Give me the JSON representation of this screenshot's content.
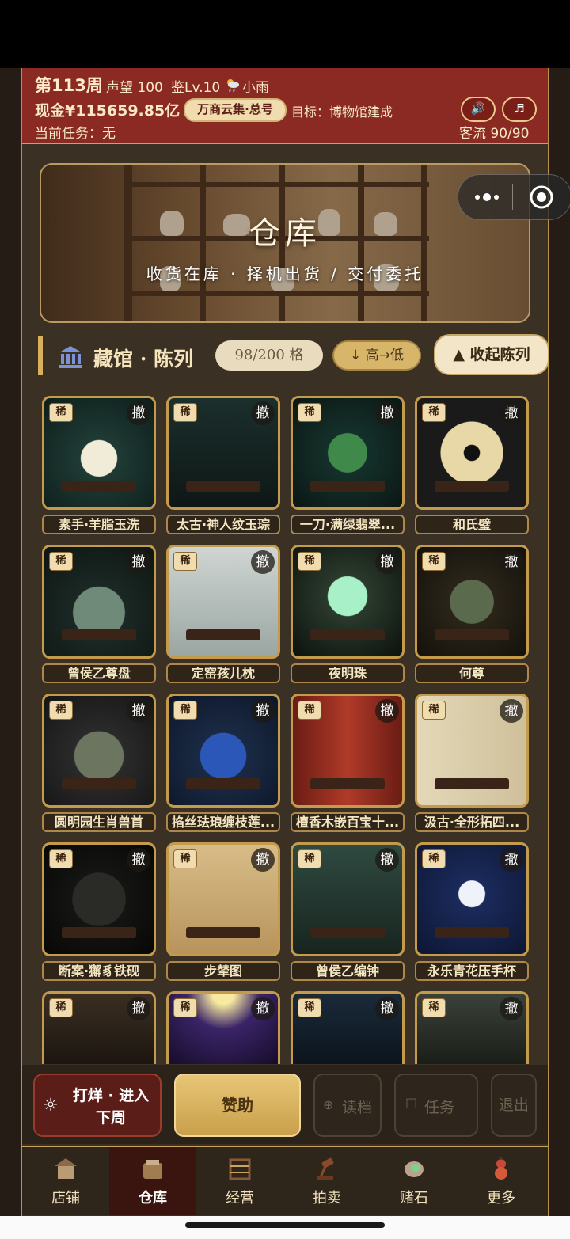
{
  "header": {
    "week": "第113周",
    "prestige": "声望 100",
    "level": "鉴Lv.10",
    "weather_icon": "cloud-rain-icon",
    "weather": "小雨",
    "cash": "现金¥115659.85亿",
    "shop_badge": "万商云集·总号",
    "goal": "目标：博物馆建成",
    "task": "当前任务：无",
    "sound_icon": "speaker-icon",
    "music_icon": "music-note-icon",
    "visitors": "客流 90/90"
  },
  "banner": {
    "title": "仓库",
    "subtitle": "收货在库 · 择机出货 / 交付委托"
  },
  "section": {
    "title": "藏馆 · 陈列",
    "count": "98/200 格",
    "sort": "↓ 高→低",
    "collapse": "▲ 收起陈列"
  },
  "labels": {
    "rare": "稀",
    "withdraw": "撤"
  },
  "items": [
    {
      "name": "素手·羊脂玉洗"
    },
    {
      "name": "太古·神人纹玉琮"
    },
    {
      "name": "一刀·满绿翡翠..."
    },
    {
      "name": "和氏璧"
    },
    {
      "name": "曾侯乙尊盘"
    },
    {
      "name": "定窑孩儿枕"
    },
    {
      "name": "夜明珠"
    },
    {
      "name": "何尊"
    },
    {
      "name": "圆明园生肖兽首"
    },
    {
      "name": "掐丝珐琅缠枝莲..."
    },
    {
      "name": "檀香木嵌百宝十..."
    },
    {
      "name": "汲古·全形拓四..."
    },
    {
      "name": "断案·獬豸铁砚"
    },
    {
      "name": "步辇图"
    },
    {
      "name": "曾侯乙编钟"
    },
    {
      "name": "永乐青花压手杯"
    },
    {
      "name": ""
    },
    {
      "name": ""
    },
    {
      "name": ""
    },
    {
      "name": ""
    }
  ],
  "actions": {
    "next_week": "打烊 · 进入下周",
    "sponsor": "赞助",
    "load": "读档",
    "tasks": "任务",
    "exit": "退出"
  },
  "nav": [
    {
      "label": "店铺"
    },
    {
      "label": "仓库"
    },
    {
      "label": "经营"
    },
    {
      "label": "拍卖"
    },
    {
      "label": "赌石"
    },
    {
      "label": "更多"
    }
  ],
  "colors": {
    "header_red": "#8a2a22",
    "gold": "#c9a45e",
    "panel_dark": "#3a3024",
    "sponsor_gold": "#d9b45f"
  }
}
